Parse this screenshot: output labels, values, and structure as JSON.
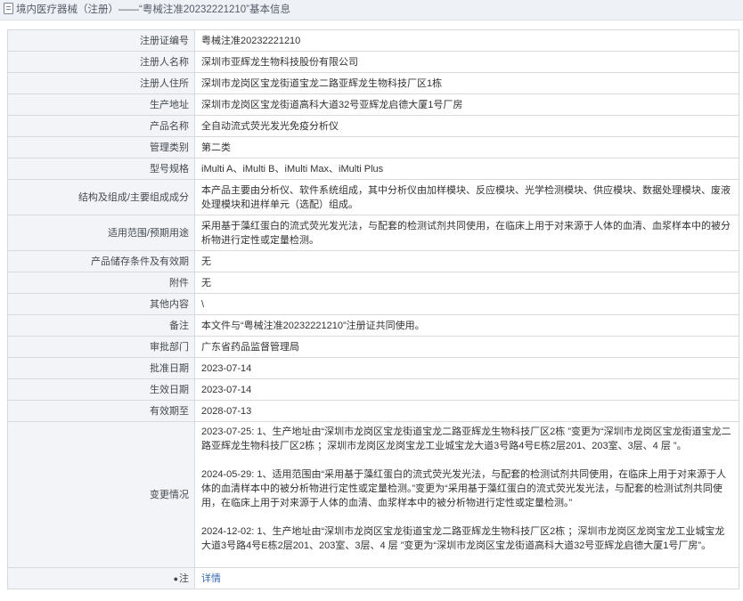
{
  "breadcrumb": {
    "text": "境内医疗器械（注册）——“粤械注准20232221210”基本信息"
  },
  "rows": [
    {
      "label": "注册证编号",
      "value": "粤械注准20232221210"
    },
    {
      "label": "注册人名称",
      "value": "深圳市亚辉龙生物科技股份有限公司"
    },
    {
      "label": "注册人住所",
      "value": "深圳市龙岗区宝龙街道宝龙二路亚辉龙生物科技厂区1栋"
    },
    {
      "label": "生产地址",
      "value": "深圳市龙岗区宝龙街道高科大道32号亚辉龙启德大厦1号厂房"
    },
    {
      "label": "产品名称",
      "value": "全自动流式荧光发光免疫分析仪"
    },
    {
      "label": "管理类别",
      "value": "第二类"
    },
    {
      "label": "型号规格",
      "value": "iMulti A、iMulti B、iMulti Max、iMulti Plus"
    },
    {
      "label": "结构及组成/主要组成成分",
      "value": "本产品主要由分析仪、软件系统组成，其中分析仪由加样模块、反应模块、光学检测模块、供应模块、数据处理模块、废液处理模块和进样单元（选配）组成。"
    },
    {
      "label": "适用范围/预期用途",
      "value": "采用基于藻红蛋白的流式荧光发光法，与配套的检测试剂共同使用，在临床上用于对来源于人体的血清、血浆样本中的被分析物进行定性或定量检测。"
    },
    {
      "label": "产品储存条件及有效期",
      "value": "无"
    },
    {
      "label": "附件",
      "value": "无"
    },
    {
      "label": "其他内容",
      "value": "\\"
    },
    {
      "label": "备注",
      "value": "本文件与“粤械注准20232221210”注册证共同使用。"
    },
    {
      "label": "审批部门",
      "value": "广东省药品监督管理局"
    },
    {
      "label": "批准日期",
      "value": "2023-07-14"
    },
    {
      "label": "生效日期",
      "value": "2023-07-14"
    },
    {
      "label": "有效期至",
      "value": "2028-07-13"
    }
  ],
  "changes": {
    "label": "变更情况",
    "entries": [
      "2023-07-25: 1、生产地址由“深圳市龙岗区宝龙街道宝龙二路亚辉龙生物科技厂区2栋 ”变更为“深圳市龙岗区宝龙街道宝龙二路亚辉龙生物科技厂区2栋 ；深圳市龙岗区龙岗宝龙工业城宝龙大道3号路4号E栋2层201、203室、3层、4 层 ”。",
      "2024-05-29: 1、适用范围由“采用基于藻红蛋白的流式荧光发光法，与配套的检测试剂共同使用，在临床上用于对来源于人体的血清样本中的被分析物进行定性或定量检测。”变更为“采用基于藻红蛋白的流式荧光发光法，与配套的检测试剂共同使用，在临床上用于对来源于人体的血清、血浆样本中的被分析物进行定性或定量检测。”",
      "2024-12-02: 1、生产地址由“深圳市龙岗区宝龙街道宝龙二路亚辉龙生物科技厂区2栋 ；深圳市龙岗区龙岗宝龙工业城宝龙大道3号路4号E栋2层201、203室、3层、4 层 ”变更为“深圳市龙岗区宝龙街道高科大道32号亚辉龙启德大厦1号厂房”。"
    ]
  },
  "note": {
    "label": "注",
    "link_text": "详情"
  },
  "colors": {
    "label_bg": "#f2f4f7",
    "border": "#d6d9de",
    "link": "#3a6ab3",
    "titlebar_bg": "#eef1f5"
  }
}
